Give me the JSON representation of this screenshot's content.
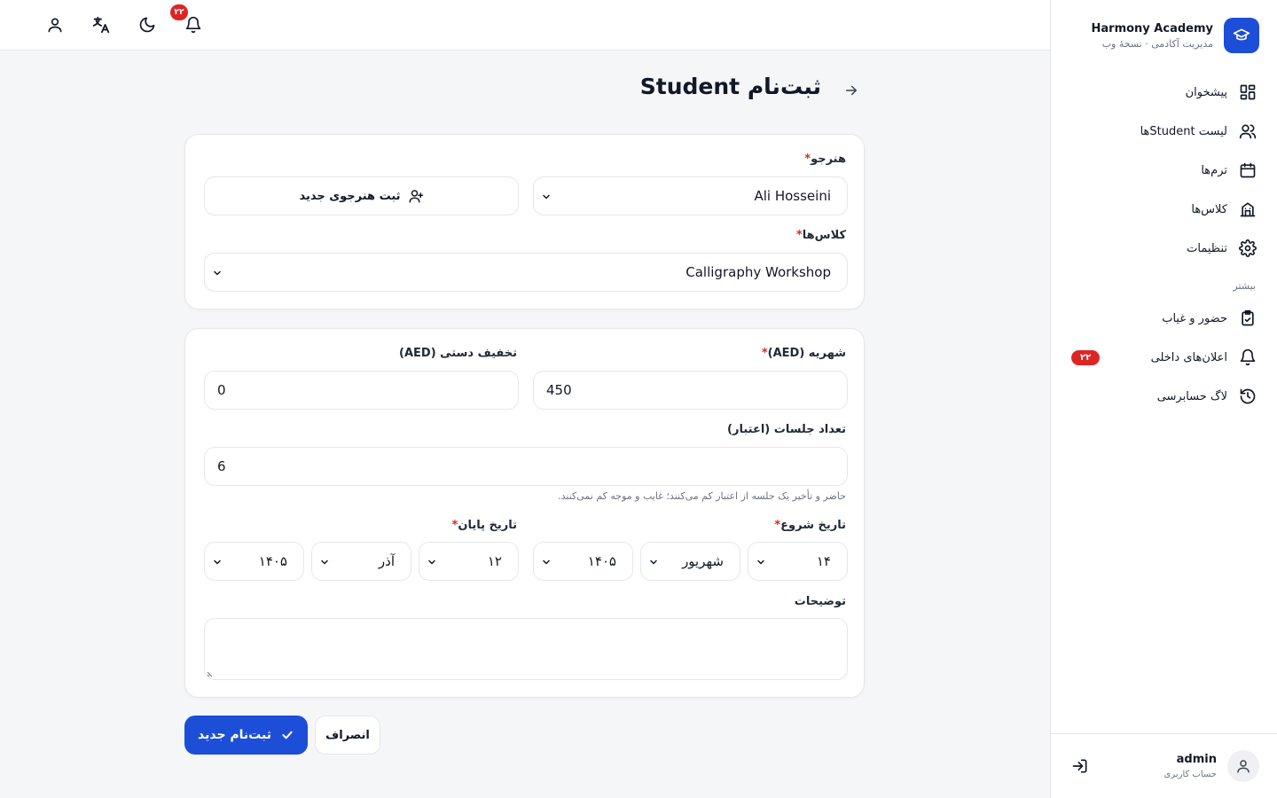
{
  "brand": {
    "name": "Harmony Academy",
    "subtitle": "مدیریت آکادمی · نسخهٔ وب",
    "logo_icon": "graduation-cap-icon",
    "accent_color": "#1d4ed8"
  },
  "sidebar": {
    "items": [
      {
        "label": "پیشخوان",
        "icon": "dashboard-icon"
      },
      {
        "label": "لیست Studentها",
        "icon": "users-icon"
      },
      {
        "label": "ترم‌ها",
        "icon": "calendar-icon"
      },
      {
        "label": "کلاس‌ها",
        "icon": "building-icon"
      },
      {
        "label": "تنظیمات",
        "icon": "gear-icon"
      }
    ],
    "section_more": "بیشتر",
    "more_items": [
      {
        "label": "حضور و غیاب",
        "icon": "clipboard-icon"
      },
      {
        "label": "اعلان‌های داخلی",
        "icon": "bell-icon",
        "badge": "۲۲"
      },
      {
        "label": "لاگ حسابرسی",
        "icon": "history-icon"
      }
    ]
  },
  "user": {
    "name": "admin",
    "role": "حساب کاربری"
  },
  "topbar": {
    "notification_count": "۲۲"
  },
  "page": {
    "title": "ثبت‌نام Student"
  },
  "form": {
    "student_label": "هنرجو",
    "student_value": "Ali Hosseini",
    "new_student_button": "ثبت هنرجوی جدید",
    "classes_label": "کلاس‌ها",
    "classes_value": "Calligraphy Workshop",
    "tuition_label": "شهریه (AED)",
    "tuition_value": "450",
    "discount_label": "تخفیف دستی (AED)",
    "discount_value": "0",
    "sessions_label": "تعداد جلسات (اعتبار)",
    "sessions_value": "6",
    "sessions_hint": "حاضر و تأخیر یک جلسه از اعتبار کم می‌کنند؛ غایب و موجه کم نمی‌کنند.",
    "start_date_label": "تاریخ شروع",
    "start_day": "۱۴",
    "start_month": "شهریور",
    "start_year": "۱۴۰۵",
    "end_date_label": "تاریخ پایان",
    "end_day": "۱۲",
    "end_month": "آذر",
    "end_year": "۱۴۰۵",
    "notes_label": "توضیحات",
    "notes_value": "",
    "required_mark": "*"
  },
  "actions": {
    "submit_label": "ثبت‌نام جدید",
    "cancel_label": "انصراف"
  }
}
